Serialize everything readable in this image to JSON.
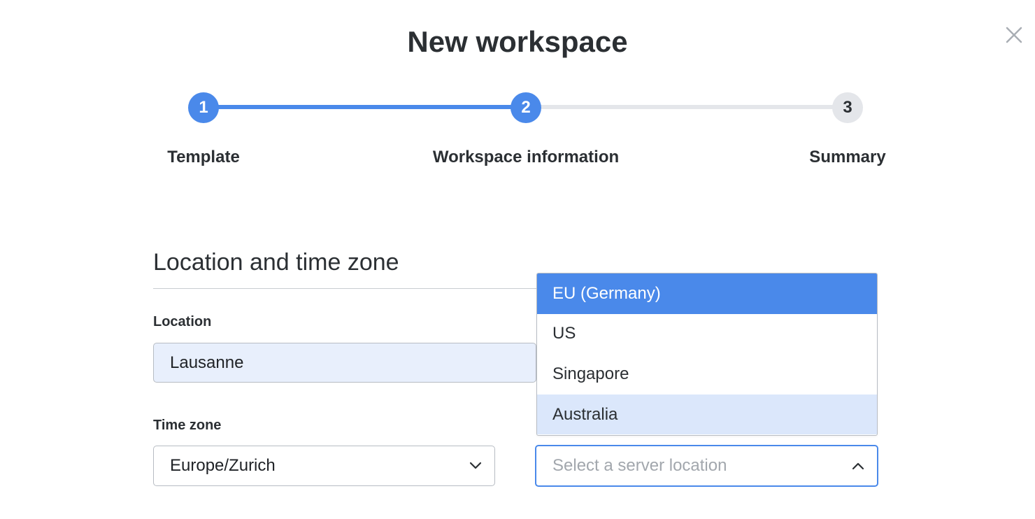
{
  "dialog": {
    "title": "New workspace",
    "close_icon": "close-icon"
  },
  "stepper": {
    "steps": [
      {
        "number": "1",
        "label": "Template",
        "state": "completed"
      },
      {
        "number": "2",
        "label": "Workspace information",
        "state": "current"
      },
      {
        "number": "3",
        "label": "Summary",
        "state": "pending"
      }
    ],
    "active_color": "#4a89ea",
    "inactive_color": "#e4e6ea"
  },
  "section": {
    "title": "Location and time zone"
  },
  "location": {
    "label": "Location",
    "value": "Lausanne"
  },
  "time_zone": {
    "label": "Time zone",
    "value": "Europe/Zurich",
    "icon": "chevron-down-icon"
  },
  "server_location": {
    "placeholder": "Select a server location",
    "icon": "chevron-up-icon",
    "options": [
      {
        "label": "EU (Germany)",
        "state": "selected"
      },
      {
        "label": "US",
        "state": "normal"
      },
      {
        "label": "Singapore",
        "state": "normal"
      },
      {
        "label": "Australia",
        "state": "hover"
      }
    ]
  }
}
